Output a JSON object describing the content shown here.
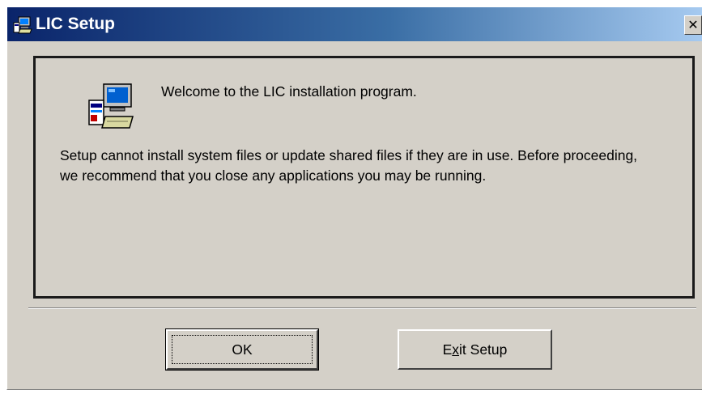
{
  "window": {
    "title": "LIC Setup",
    "close_glyph": "✕",
    "icon": "setup-computer-icon"
  },
  "content": {
    "icon": "setup-computer-icon",
    "welcome": "Welcome to the LIC installation program.",
    "message": "Setup cannot install system files or update shared files if they are in use. Before proceeding, we recommend that you close any applications you may be running."
  },
  "buttons": {
    "ok_label": "OK",
    "exit_prefix": "E",
    "exit_mnemonic": "x",
    "exit_suffix": "it Setup"
  },
  "colors": {
    "dialog_face": "#d4d0c8",
    "title_start": "#0a246a",
    "title_end": "#a6caf0"
  }
}
